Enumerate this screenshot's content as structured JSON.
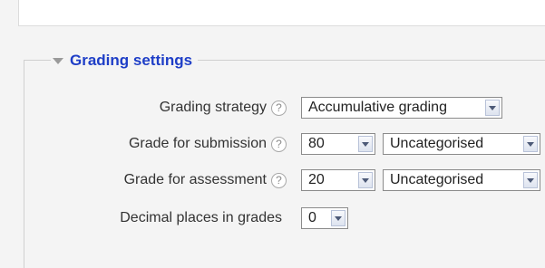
{
  "section": {
    "title": "Grading settings"
  },
  "fields": {
    "grading_strategy": {
      "label": "Grading strategy",
      "value": "Accumulative grading"
    },
    "grade_submission": {
      "label": "Grade for submission",
      "value": "80",
      "category": "Uncategorised"
    },
    "grade_assessment": {
      "label": "Grade for assessment",
      "value": "20",
      "category": "Uncategorised"
    },
    "decimal_places": {
      "label": "Decimal places in grades",
      "value": "0"
    }
  },
  "icons": {
    "help": "?",
    "collapse": "triangle-down",
    "dropdown": "chevron-down"
  },
  "colors": {
    "legend_title": "#1e3ec7",
    "background": "#f4f4f4",
    "label_text": "#333333"
  }
}
